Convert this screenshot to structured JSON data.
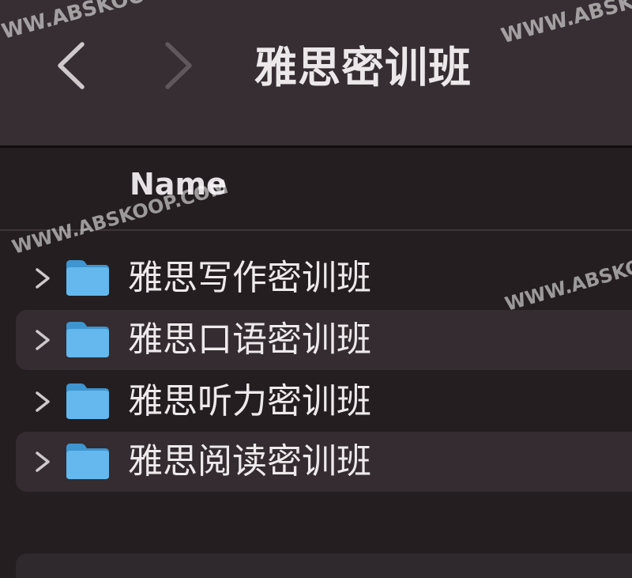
{
  "toolbar": {
    "title": "雅思密训班",
    "back_icon": "chevron-left-icon",
    "forward_icon": "chevron-right-icon"
  },
  "columns": {
    "name": "Name"
  },
  "rows": [
    {
      "label": "雅思写作密训班",
      "icon": "folder-icon"
    },
    {
      "label": "雅思口语密训班",
      "icon": "folder-icon"
    },
    {
      "label": "雅思听力密训班",
      "icon": "folder-icon"
    },
    {
      "label": "雅思阅读密训班",
      "icon": "folder-icon"
    }
  ],
  "watermarks": [
    "WWW.ABSKOOP.COM",
    "WWW.ABSKOOP.COM",
    "WWW.ABSKOOP.COM",
    "WWW.ABSKOOP.COM"
  ],
  "colors": {
    "toolbar_bg": "#362e32",
    "list_bg": "#241e21",
    "alt_row_bg": "#342c30",
    "folder_blue": "#5fb4ea",
    "text": "#eeeaec"
  }
}
